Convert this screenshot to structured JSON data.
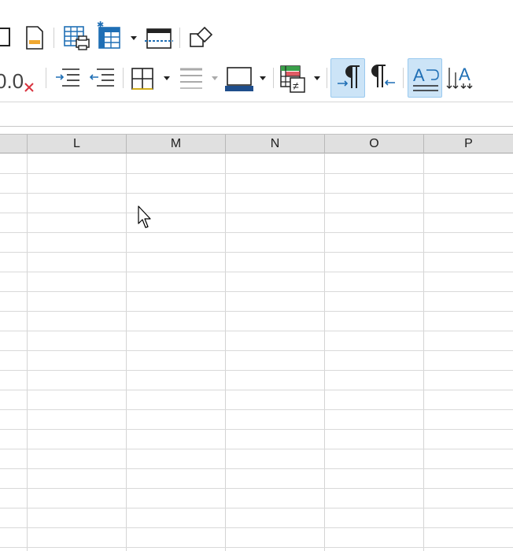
{
  "toolbar_top": {
    "items": [
      "frame-icon",
      "page-icon",
      "table-print-icon",
      "freeze-rows-icon",
      "page-break-icon",
      "shapes-icon"
    ]
  },
  "toolbar_format": {
    "decimal_label": "0.0",
    "items": [
      "delete-decimal-icon",
      "increase-indent-icon",
      "decrease-indent-icon",
      "borders-icon",
      "border-style-icon",
      "border-color-icon",
      "conditional-format-icon",
      "left-to-right-icon",
      "right-to-left-icon",
      "wrap-text-icon",
      "vertical-text-icon"
    ],
    "active": [
      "left-to-right-icon",
      "wrap-text-icon"
    ]
  },
  "colors": {
    "accent": "#1f6fb5",
    "active_bg": "#cce4f7",
    "header_bg": "#e0e0e0",
    "grid_line": "#d4d4d4",
    "red": "#d9333f"
  },
  "columns": [
    "L",
    "M",
    "N",
    "O",
    "P"
  ]
}
